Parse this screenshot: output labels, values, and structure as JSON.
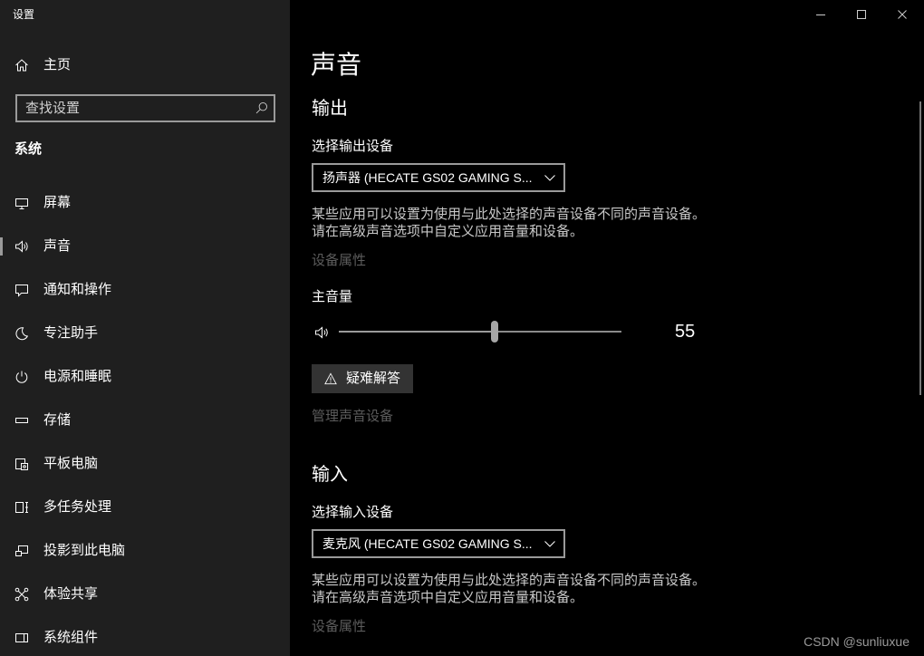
{
  "window": {
    "title": "设置",
    "controls": {
      "minimize_icon": "minimize-icon",
      "maximize_icon": "maximize-icon",
      "close_icon": "close-icon"
    }
  },
  "colors": {
    "sidebar_bg": "#1f1f1f",
    "main_bg": "#000000",
    "text": "#ffffff",
    "secondary_text": "#c8c8c8",
    "disabled_text": "#5c5c5c",
    "control_border": "#9a9a9a",
    "button_bg": "#333333",
    "selection_indicator": "#9a9a9a",
    "slider_track": "#8a8a8a",
    "slider_thumb": "#a6a6a6",
    "placeholder_text": "#cfcfcf",
    "watermark_text": "#9a9a9a"
  },
  "sidebar": {
    "home": {
      "label": "主页",
      "icon": "home-icon"
    },
    "search": {
      "placeholder": "查找设置",
      "icon": "search-icon"
    },
    "section_title": "系统",
    "items": [
      {
        "label": "屏幕",
        "icon": "display-icon",
        "selected": false
      },
      {
        "label": "声音",
        "icon": "speaker-icon",
        "selected": true
      },
      {
        "label": "通知和操作",
        "icon": "notification-icon",
        "selected": false
      },
      {
        "label": "专注助手",
        "icon": "moon-icon",
        "selected": false
      },
      {
        "label": "电源和睡眠",
        "icon": "power-icon",
        "selected": false
      },
      {
        "label": "存储",
        "icon": "storage-icon",
        "selected": false
      },
      {
        "label": "平板电脑",
        "icon": "tablet-icon",
        "selected": false
      },
      {
        "label": "多任务处理",
        "icon": "multitasking-icon",
        "selected": false
      },
      {
        "label": "投影到此电脑",
        "icon": "projecting-icon",
        "selected": false
      },
      {
        "label": "体验共享",
        "icon": "shared-experiences-icon",
        "selected": false
      },
      {
        "label": "系统组件",
        "icon": "system-components-icon",
        "selected": false
      }
    ]
  },
  "main": {
    "page_title": "声音",
    "output": {
      "heading": "输出",
      "device_label": "选择输出设备",
      "device_selected": "扬声器 (HECATE GS02 GAMING S...",
      "dropdown_icon": "chevron-down-icon",
      "description": [
        "某些应用可以设置为使用与此处选择的声音设备不同的声音设备。",
        "请在高级声音选项中自定义应用音量和设备。"
      ],
      "device_properties_link": "设备属性",
      "volume": {
        "label": "主音量",
        "value": 55,
        "icon": "volume-icon"
      },
      "troubleshoot_button": {
        "label": "疑难解答",
        "icon": "warning-icon"
      },
      "manage_devices_link": "管理声音设备"
    },
    "input": {
      "heading": "输入",
      "device_label": "选择输入设备",
      "device_selected": "麦克风 (HECATE GS02 GAMING S...",
      "dropdown_icon": "chevron-down-icon",
      "description": [
        "某些应用可以设置为使用与此处选择的声音设备不同的声音设备。",
        "请在高级声音选项中自定义应用音量和设备。"
      ],
      "device_properties_link": "设备属性"
    }
  },
  "watermark": "CSDN @sunliuxue"
}
